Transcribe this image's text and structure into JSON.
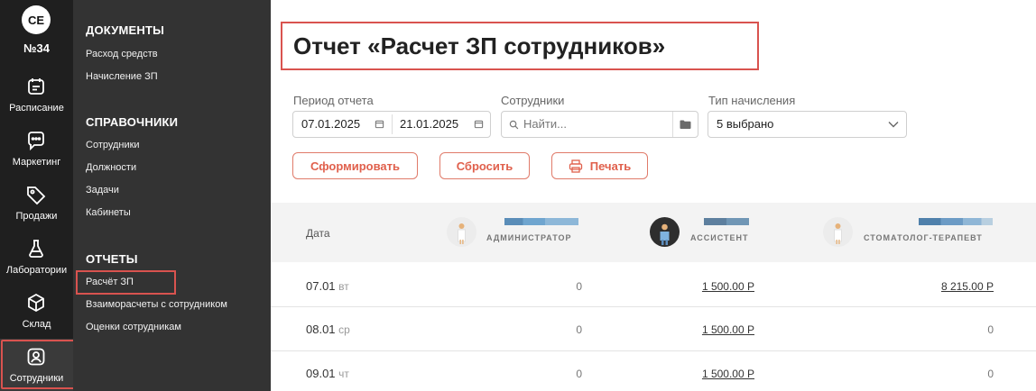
{
  "rail": {
    "avatar": "СЕ",
    "clinic": "№34",
    "items": [
      {
        "label": "Расписание",
        "icon": "calendar-icon"
      },
      {
        "label": "Маркетинг",
        "icon": "chat-icon"
      },
      {
        "label": "Продажи",
        "icon": "tag-icon"
      },
      {
        "label": "Лаборатории",
        "icon": "flask-icon"
      },
      {
        "label": "Склад",
        "icon": "box-icon"
      },
      {
        "label": "Сотрудники",
        "icon": "user-icon"
      }
    ]
  },
  "submenu": {
    "documents": {
      "title": "ДОКУМЕНТЫ",
      "links": [
        "Расход средств",
        "Начисление ЗП"
      ]
    },
    "references": {
      "title": "СПРАВОЧНИКИ",
      "links": [
        "Сотрудники",
        "Должности",
        "Задачи",
        "Кабинеты"
      ]
    },
    "reports": {
      "title": "ОТЧЕТЫ",
      "links": [
        "Расчёт ЗП",
        "Взаиморасчеты с сотрудником",
        "Оценки сотрудникам"
      ]
    }
  },
  "page": {
    "title": "Отчет «Расчет ЗП сотрудников»"
  },
  "filters": {
    "period_label": "Период отчета",
    "date_from": "07.01.2025",
    "date_to": "21.01.2025",
    "employees_label": "Сотрудники",
    "search_placeholder": "Найти...",
    "accrual_label": "Тип начисления",
    "accrual_value": "5 выбрано"
  },
  "buttons": {
    "generate": "Сформировать",
    "reset": "Сбросить",
    "print": "Печать"
  },
  "table": {
    "date_header": "Дата",
    "employees": [
      {
        "role": "АДМИНИСТРАТОР"
      },
      {
        "role": "АССИСТЕНТ"
      },
      {
        "role": "СТОМАТОЛОГ-ТЕРАПЕВТ"
      }
    ],
    "rows": [
      {
        "date": "07.01",
        "weekday": "вт",
        "v1": "0",
        "v2": "1 500.00 Р",
        "v3": "8 215.00 Р"
      },
      {
        "date": "08.01",
        "weekday": "ср",
        "v1": "0",
        "v2": "1 500.00 Р",
        "v3": "0"
      },
      {
        "date": "09.01",
        "weekday": "чт",
        "v1": "0",
        "v2": "1 500.00 Р",
        "v3": "0"
      }
    ]
  },
  "colors": {
    "accent": "#e0604c",
    "highlight": "#d9534f",
    "rail": "#1f1f1f",
    "submenu": "#333333"
  }
}
